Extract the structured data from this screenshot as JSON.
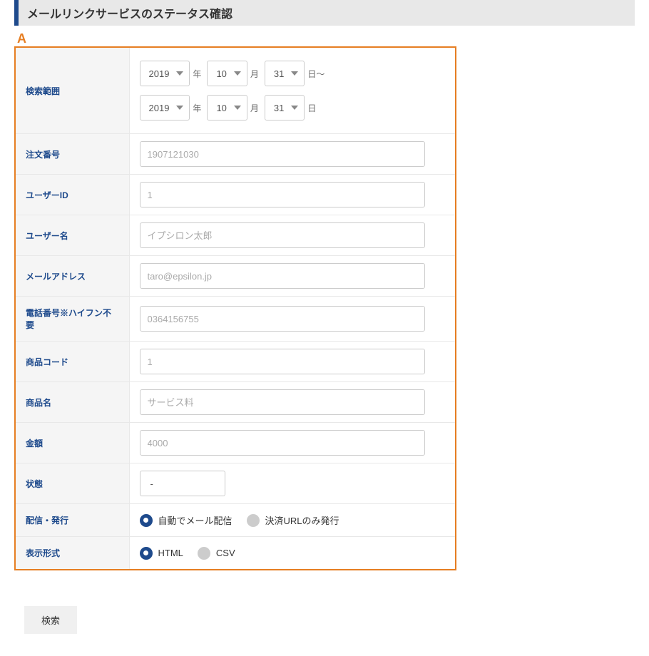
{
  "header": {
    "title": "メールリンクサービスのステータス確認"
  },
  "marker": "A",
  "form": {
    "searchRange": {
      "label": "検索範囲",
      "from": {
        "year": "2019",
        "month": "10",
        "day": "31",
        "yearUnit": "年",
        "monthUnit": "月",
        "dayUnit": "日～"
      },
      "to": {
        "year": "2019",
        "month": "10",
        "day": "31",
        "yearUnit": "年",
        "monthUnit": "月",
        "dayUnit": "日"
      }
    },
    "orderNo": {
      "label": "注文番号",
      "placeholder": "1907121030"
    },
    "userId": {
      "label": "ユーザーID",
      "placeholder": "1"
    },
    "userName": {
      "label": "ユーザー名",
      "placeholder": "イプシロン太郎"
    },
    "email": {
      "label": "メールアドレス",
      "placeholder": "taro@epsilon.jp"
    },
    "phone": {
      "label": "電話番号※ハイフン不要",
      "placeholder": "0364156755"
    },
    "itemCode": {
      "label": "商品コード",
      "placeholder": "1"
    },
    "itemName": {
      "label": "商品名",
      "placeholder": "サービス料"
    },
    "amount": {
      "label": "金額",
      "placeholder": "4000"
    },
    "status": {
      "label": "状態",
      "value": "-"
    },
    "delivery": {
      "label": "配信・発行",
      "opt1": "自動でメール配信",
      "opt2": "決済URLのみ発行"
    },
    "format": {
      "label": "表示形式",
      "opt1": "HTML",
      "opt2": "CSV"
    }
  },
  "searchButton": "検索"
}
